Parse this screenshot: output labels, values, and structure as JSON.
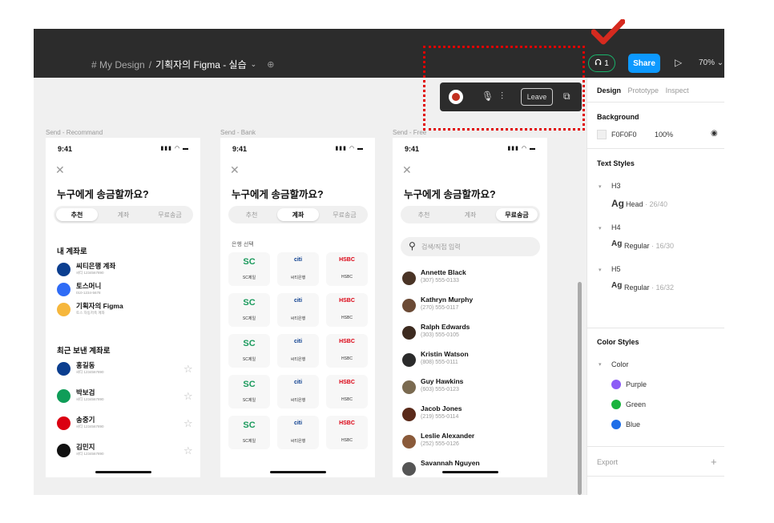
{
  "toolbar": {
    "project": "# My Design",
    "separator": "/",
    "file_name": "기획자의 Figma - 실습",
    "share_label": "Share",
    "huddle_count": "1",
    "zoom": "70%"
  },
  "audio_bar": {
    "leave_label": "Leave"
  },
  "frames": [
    {
      "label": "Send - Recommand",
      "time": "9:41",
      "title": "누구에게 송금할까요?"
    },
    {
      "label": "Send - Bank",
      "time": "9:41",
      "title": "누구에게 송금할까요?"
    },
    {
      "label": "Send - Free",
      "time": "9:41",
      "title": "누구에게 송금할까요?"
    }
  ],
  "tabs": [
    "추천",
    "계좌",
    "무료송금"
  ],
  "recommand": {
    "my_accounts_title": "내 계좌로",
    "my_accounts": [
      {
        "name": "씨티은행 계좌",
        "sub": "씨티 1234567890",
        "color": "#0b3e8f",
        "logo": "citi"
      },
      {
        "name": "토스머니",
        "sub": "010-1234-5678",
        "color": "#2f6cf6",
        "logo": "toss"
      },
      {
        "name": "기획자의 Figma",
        "sub": "토스 자동저축 계좌",
        "color": "#f6b73c",
        "logo": "figma"
      }
    ],
    "recent_title": "최근 보낸 계좌로",
    "recent": [
      {
        "name": "홍길동",
        "sub": "씨티 1234567890",
        "color": "#0b3e8f",
        "logo": "citi"
      },
      {
        "name": "박보검",
        "sub": "씨티 1234567890",
        "color": "#0f9d58",
        "logo": "sc"
      },
      {
        "name": "송중기",
        "sub": "씨티 1234567890",
        "color": "#db0011",
        "logo": "hsbc"
      },
      {
        "name": "김민지",
        "sub": "씨티 1234567890",
        "color": "#111111",
        "logo": "b"
      }
    ]
  },
  "bank": {
    "section_title": "은행 선택",
    "banks": [
      {
        "name": "SC제일",
        "logo": "SC",
        "color": "#1a9a5c"
      },
      {
        "name": "씨티은행",
        "logo": "citi",
        "color": "#0b3e8f"
      },
      {
        "name": "HSBC",
        "logo": "HSBC",
        "color": "#db0011"
      }
    ]
  },
  "free": {
    "search_placeholder": "검색/직접 입력",
    "contacts": [
      {
        "name": "Annette Black",
        "phone": "(307) 555-0133"
      },
      {
        "name": "Kathryn Murphy",
        "phone": "(270) 555-0117"
      },
      {
        "name": "Ralph Edwards",
        "phone": "(303) 555-0105"
      },
      {
        "name": "Kristin Watson",
        "phone": "(808) 555-0111"
      },
      {
        "name": "Guy Hawkins",
        "phone": "(603) 555-0123"
      },
      {
        "name": "Jacob Jones",
        "phone": "(219) 555-0114"
      },
      {
        "name": "Leslie Alexander",
        "phone": "(252) 555-0126"
      },
      {
        "name": "Savannah Nguyen",
        "phone": ""
      }
    ]
  },
  "panel": {
    "tabs": [
      "Design",
      "Prototype",
      "Inspect"
    ],
    "background_title": "Background",
    "background_hex": "F0F0F0",
    "background_opacity": "100%",
    "text_styles_title": "Text Styles",
    "text_groups": [
      {
        "group": "H3",
        "style": "Head",
        "size": "· 26/40"
      },
      {
        "group": "H4",
        "style": "Regular",
        "size": "· 16/30"
      },
      {
        "group": "H5",
        "style": "Regular",
        "size": "· 16/32"
      }
    ],
    "ag": "Ag",
    "color_styles_title": "Color Styles",
    "color_group": "Color",
    "colors": [
      {
        "name": "Purple",
        "hex": "#8c5cf6"
      },
      {
        "name": "Green",
        "hex": "#19b33d"
      },
      {
        "name": "Blue",
        "hex": "#1e6ee8"
      }
    ],
    "export_title": "Export",
    "export_add": "+"
  }
}
